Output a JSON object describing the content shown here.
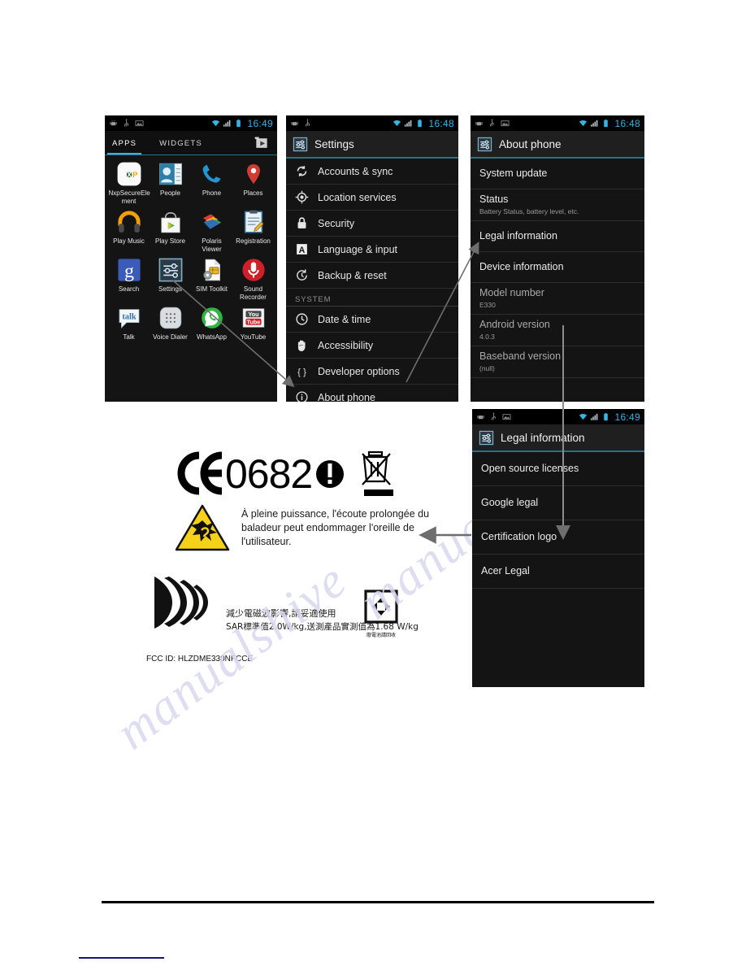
{
  "document": {
    "type": "manual-page",
    "watermark_text": "manualshive"
  },
  "screens": {
    "apps": {
      "name": "apps-drawer",
      "statusbar": {
        "clock": "16:49",
        "icons": [
          "android-debug-icon",
          "usb-icon",
          "screenshot-icon",
          "wifi-icon",
          "signal-icon",
          "battery-icon"
        ]
      },
      "tabs": [
        {
          "label": "APPS",
          "active": true
        },
        {
          "label": "WIDGETS",
          "active": false
        }
      ],
      "store_button": "play-store-button",
      "apps": [
        {
          "label": "NxpSecureEle ment",
          "icon": "nxp-icon"
        },
        {
          "label": "People",
          "icon": "people-icon"
        },
        {
          "label": "Phone",
          "icon": "phone-icon"
        },
        {
          "label": "Places",
          "icon": "places-icon"
        },
        {
          "label": "Play Music",
          "icon": "play-music-icon"
        },
        {
          "label": "Play Store",
          "icon": "play-store-icon"
        },
        {
          "label": "Polaris Viewer",
          "icon": "polaris-viewer-icon"
        },
        {
          "label": "Registration",
          "icon": "registration-icon"
        },
        {
          "label": "Search",
          "icon": "google-search-icon"
        },
        {
          "label": "Settings",
          "icon": "settings-icon"
        },
        {
          "label": "SIM Toolkit",
          "icon": "sim-toolkit-icon"
        },
        {
          "label": "Sound Recorder",
          "icon": "sound-recorder-icon"
        },
        {
          "label": "Talk",
          "icon": "talk-icon"
        },
        {
          "label": "Voice Dialer",
          "icon": "voice-dialer-icon"
        },
        {
          "label": "WhatsApp",
          "icon": "whatsapp-icon"
        },
        {
          "label": "YouTube",
          "icon": "youtube-icon"
        }
      ]
    },
    "settings": {
      "name": "settings-screen",
      "statusbar": {
        "clock": "16:48",
        "icons": [
          "android-debug-icon",
          "usb-icon",
          "wifi-icon",
          "signal-icon",
          "battery-icon"
        ]
      },
      "title": "Settings",
      "title_icon": "settings-icon",
      "items": [
        {
          "label": "Accounts & sync",
          "icon": "sync-icon",
          "type": "item"
        },
        {
          "label": "Location services",
          "icon": "location-icon",
          "type": "item"
        },
        {
          "label": "Security",
          "icon": "lock-icon",
          "type": "item"
        },
        {
          "label": "Language & input",
          "icon": "language-icon",
          "type": "item"
        },
        {
          "label": "Backup & reset",
          "icon": "backup-reset-icon",
          "type": "item"
        },
        {
          "label": "SYSTEM",
          "icon": "",
          "type": "section"
        },
        {
          "label": "Date & time",
          "icon": "clock-icon",
          "type": "item"
        },
        {
          "label": "Accessibility",
          "icon": "hand-icon",
          "type": "item"
        },
        {
          "label": "Developer options",
          "icon": "braces-icon",
          "type": "item"
        },
        {
          "label": "About phone",
          "icon": "info-icon",
          "type": "item"
        }
      ]
    },
    "about_phone": {
      "name": "about-phone-screen",
      "statusbar": {
        "clock": "16:48",
        "icons": [
          "android-debug-icon",
          "usb-icon",
          "screenshot-icon",
          "wifi-icon",
          "signal-icon",
          "battery-icon"
        ]
      },
      "title": "About phone",
      "title_icon": "settings-icon",
      "items": [
        {
          "title": "System update",
          "sub": ""
        },
        {
          "title": "Status",
          "sub": "Battery Status, battery level, etc."
        },
        {
          "title": "Legal information",
          "sub": ""
        },
        {
          "title": "Device information",
          "sub": ""
        },
        {
          "title": "Model number",
          "sub": "E330",
          "dim": true
        },
        {
          "title": "Android version",
          "sub": "4.0.3",
          "dim": true
        },
        {
          "title": "Baseband version",
          "sub": "(null)",
          "dim": true
        }
      ]
    },
    "legal": {
      "name": "legal-information-screen",
      "statusbar": {
        "clock": "16:49",
        "icons": [
          "android-debug-icon",
          "usb-icon",
          "screenshot-icon",
          "wifi-icon",
          "signal-icon",
          "battery-icon"
        ]
      },
      "title": "Legal information",
      "title_icon": "settings-icon",
      "items": [
        {
          "title": "Open source licenses"
        },
        {
          "title": "Google legal"
        },
        {
          "title": "Certification logo"
        },
        {
          "title": "Acer Legal"
        }
      ]
    }
  },
  "certification": {
    "ce_mark": "CE",
    "notified_body_number": "0682",
    "alert_symbol": "!",
    "weee_icon": "crossed-out-wheelie-bin-icon",
    "hearing_warning_icon": "hearing-damage-warning-icon",
    "hearing_warning_text": "À pleine puissance, l'écoute prolongée du baladeur peut endommager l'oreille de l'utilisateur.",
    "ncc_icon": "sar-waves-icon",
    "sar_line1": "減少電磁波影響,請妥適使用",
    "sar_line2": "SAR標準值2.0W/kg,送測產品實測值為1.68 W/kg",
    "battery_recycle_icon": "battery-recycling-icon",
    "battery_recycle_caption": "廢電池請回收",
    "fcc_id": "FCC ID: HLZDME330NFCCE"
  },
  "colors": {
    "accent_blue": "#33b5e5",
    "screen_bg": "#141414",
    "actionbar_bg": "#1f1f1f",
    "arrow_gray": "#6e6e6e",
    "warning_yellow": "#f5d117",
    "rule_blue": "#16167a"
  }
}
